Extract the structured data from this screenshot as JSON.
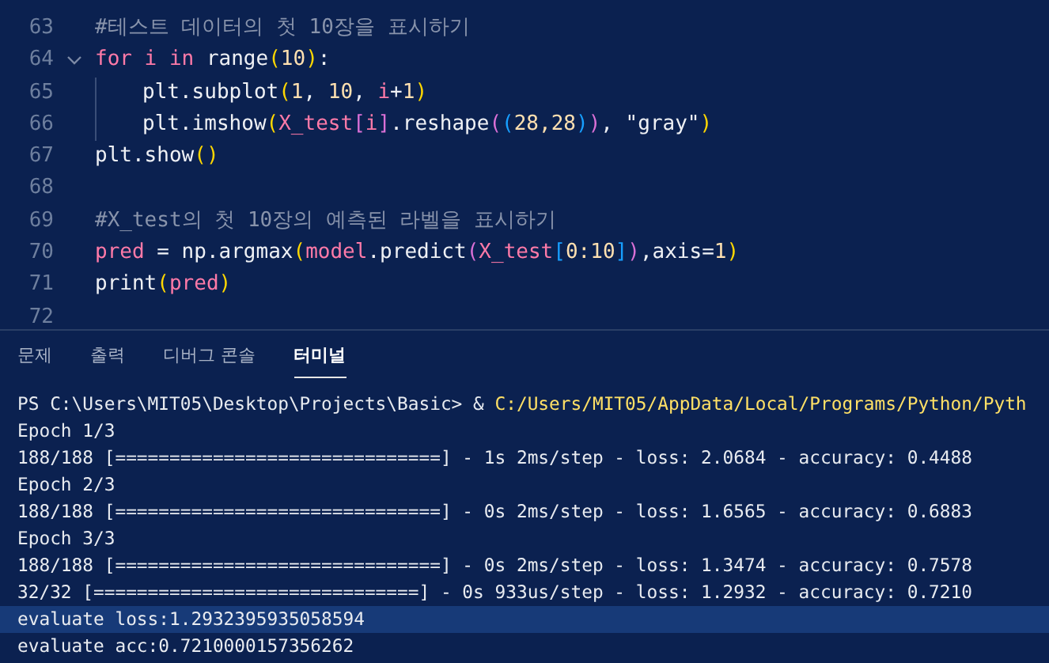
{
  "editor": {
    "lines": [
      {
        "number": "63",
        "fold": false,
        "guide": false,
        "tokens": [
          {
            "kind": "comment",
            "text": "#테스트 데이터의 첫 10장을 표시하기"
          }
        ]
      },
      {
        "number": "64",
        "fold": true,
        "guide": false,
        "tokens": [
          {
            "kind": "keyword",
            "text": "for"
          },
          {
            "kind": "var",
            "text": " i"
          },
          {
            "kind": "keyword",
            "text": " in"
          },
          {
            "kind": "func",
            "text": " range"
          },
          {
            "kind": "bracket1",
            "text": "("
          },
          {
            "kind": "number",
            "text": "10"
          },
          {
            "kind": "bracket1",
            "text": ")"
          },
          {
            "kind": "plain",
            "text": ":"
          }
        ]
      },
      {
        "number": "65",
        "fold": false,
        "guide": true,
        "tokens": [
          {
            "kind": "func",
            "text": "plt.subplot"
          },
          {
            "kind": "bracket1",
            "text": "("
          },
          {
            "kind": "number",
            "text": "1"
          },
          {
            "kind": "plain",
            "text": ", "
          },
          {
            "kind": "number",
            "text": "10"
          },
          {
            "kind": "plain",
            "text": ", "
          },
          {
            "kind": "var",
            "text": "i"
          },
          {
            "kind": "plain",
            "text": "+"
          },
          {
            "kind": "number",
            "text": "1"
          },
          {
            "kind": "bracket1",
            "text": ")"
          }
        ]
      },
      {
        "number": "66",
        "fold": false,
        "guide": true,
        "tokens": [
          {
            "kind": "func",
            "text": "plt.imshow"
          },
          {
            "kind": "bracket1",
            "text": "("
          },
          {
            "kind": "var",
            "text": "X_test"
          },
          {
            "kind": "bracket2",
            "text": "["
          },
          {
            "kind": "var",
            "text": "i"
          },
          {
            "kind": "bracket2",
            "text": "]"
          },
          {
            "kind": "func",
            "text": ".reshape"
          },
          {
            "kind": "bracket2",
            "text": "("
          },
          {
            "kind": "bracket3",
            "text": "("
          },
          {
            "kind": "number",
            "text": "28,28"
          },
          {
            "kind": "bracket3",
            "text": ")"
          },
          {
            "kind": "bracket2",
            "text": ")"
          },
          {
            "kind": "plain",
            "text": ", "
          },
          {
            "kind": "string",
            "text": "\"gray\""
          },
          {
            "kind": "bracket1",
            "text": ")"
          }
        ]
      },
      {
        "number": "67",
        "fold": false,
        "guide": false,
        "tokens": [
          {
            "kind": "func",
            "text": "plt.show"
          },
          {
            "kind": "bracket1",
            "text": "()"
          }
        ]
      },
      {
        "number": "68",
        "fold": false,
        "guide": false
      },
      {
        "number": "69",
        "fold": false,
        "guide": false,
        "tokens": [
          {
            "kind": "comment",
            "text": "#X_test의 첫 10장의 예측된 라벨을 표시하기"
          }
        ]
      },
      {
        "number": "70",
        "fold": false,
        "guide": false,
        "tokens": [
          {
            "kind": "var",
            "text": "pred"
          },
          {
            "kind": "plain",
            "text": " = "
          },
          {
            "kind": "func",
            "text": "np.argmax"
          },
          {
            "kind": "bracket1",
            "text": "("
          },
          {
            "kind": "var",
            "text": "model"
          },
          {
            "kind": "func",
            "text": ".predict"
          },
          {
            "kind": "bracket2",
            "text": "("
          },
          {
            "kind": "var",
            "text": "X_test"
          },
          {
            "kind": "bracket3",
            "text": "["
          },
          {
            "kind": "number",
            "text": "0:10"
          },
          {
            "kind": "bracket3",
            "text": "]"
          },
          {
            "kind": "bracket2",
            "text": ")"
          },
          {
            "kind": "plain",
            "text": ",axis="
          },
          {
            "kind": "number",
            "text": "1"
          },
          {
            "kind": "bracket1",
            "text": ")"
          }
        ]
      },
      {
        "number": "71",
        "fold": false,
        "guide": false,
        "tokens": [
          {
            "kind": "func",
            "text": "print"
          },
          {
            "kind": "bracket1",
            "text": "("
          },
          {
            "kind": "var",
            "text": "pred"
          },
          {
            "kind": "bracket1",
            "text": ")"
          }
        ]
      },
      {
        "number": "72",
        "fold": false,
        "guide": false
      }
    ]
  },
  "panel_tabs": [
    {
      "label": "문제",
      "selected": false
    },
    {
      "label": "출력",
      "selected": false
    },
    {
      "label": "디버그 콘솔",
      "selected": false
    },
    {
      "label": "터미널",
      "selected": true
    }
  ],
  "terminal": {
    "lines": [
      {
        "kind": "prompt",
        "prompt": "PS C:\\Users\\MIT05\\Desktop\\Projects\\Basic> & ",
        "command": "C:/Users/MIT05/AppData/Local/Programs/Python/Pyth",
        "selected": false
      },
      {
        "kind": "output",
        "text": "Epoch 1/3",
        "selected": false
      },
      {
        "kind": "output",
        "text": "188/188 [==============================] - 1s 2ms/step - loss: 2.0684 - accuracy: 0.4488",
        "selected": false
      },
      {
        "kind": "output",
        "text": "Epoch 2/3",
        "selected": false
      },
      {
        "kind": "output",
        "text": "188/188 [==============================] - 0s 2ms/step - loss: 1.6565 - accuracy: 0.6883",
        "selected": false
      },
      {
        "kind": "output",
        "text": "Epoch 3/3",
        "selected": false
      },
      {
        "kind": "output",
        "text": "188/188 [==============================] - 0s 2ms/step - loss: 1.3474 - accuracy: 0.7578",
        "selected": false
      },
      {
        "kind": "output",
        "text": "32/32 [==============================] - 0s 933us/step - loss: 1.2932 - accuracy: 0.7210",
        "selected": false
      },
      {
        "kind": "output",
        "text": "evaluate loss:1.2932395935058594",
        "selected": true
      },
      {
        "kind": "output",
        "text": "evaluate acc:0.7210000157356262",
        "selected": false
      }
    ]
  }
}
